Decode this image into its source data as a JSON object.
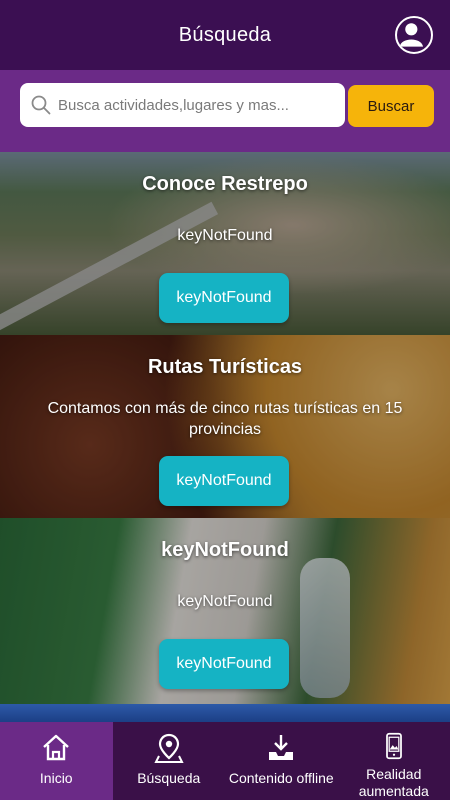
{
  "header": {
    "title": "Búsqueda",
    "avatar_icon": "user-circle-icon"
  },
  "search": {
    "placeholder": "Busca actividades,lugares y mas...",
    "button_label": "Buscar"
  },
  "cards": [
    {
      "title": "Conoce Restrepo",
      "description": "keyNotFound",
      "button_label": "keyNotFound"
    },
    {
      "title": "Rutas Turísticas",
      "description": "Contamos con más de cinco rutas turísticas en 15 provincias",
      "button_label": "keyNotFound"
    },
    {
      "title": "keyNotFound",
      "description": "keyNotFound",
      "button_label": "keyNotFound"
    }
  ],
  "tabs": [
    {
      "label": "Inicio",
      "icon": "home-icon",
      "active": true
    },
    {
      "label": "Búsqueda",
      "icon": "map-pin-icon",
      "active": false
    },
    {
      "label": "Contenido offline",
      "icon": "download-tray-icon",
      "active": false
    },
    {
      "label": "Realidad aumentada",
      "icon": "phone-image-icon",
      "active": false
    }
  ],
  "colors": {
    "header": "#3b0f52",
    "search_bar": "#6b2a87",
    "accent": "#f6b40a",
    "card_button": "#15b3c4"
  }
}
